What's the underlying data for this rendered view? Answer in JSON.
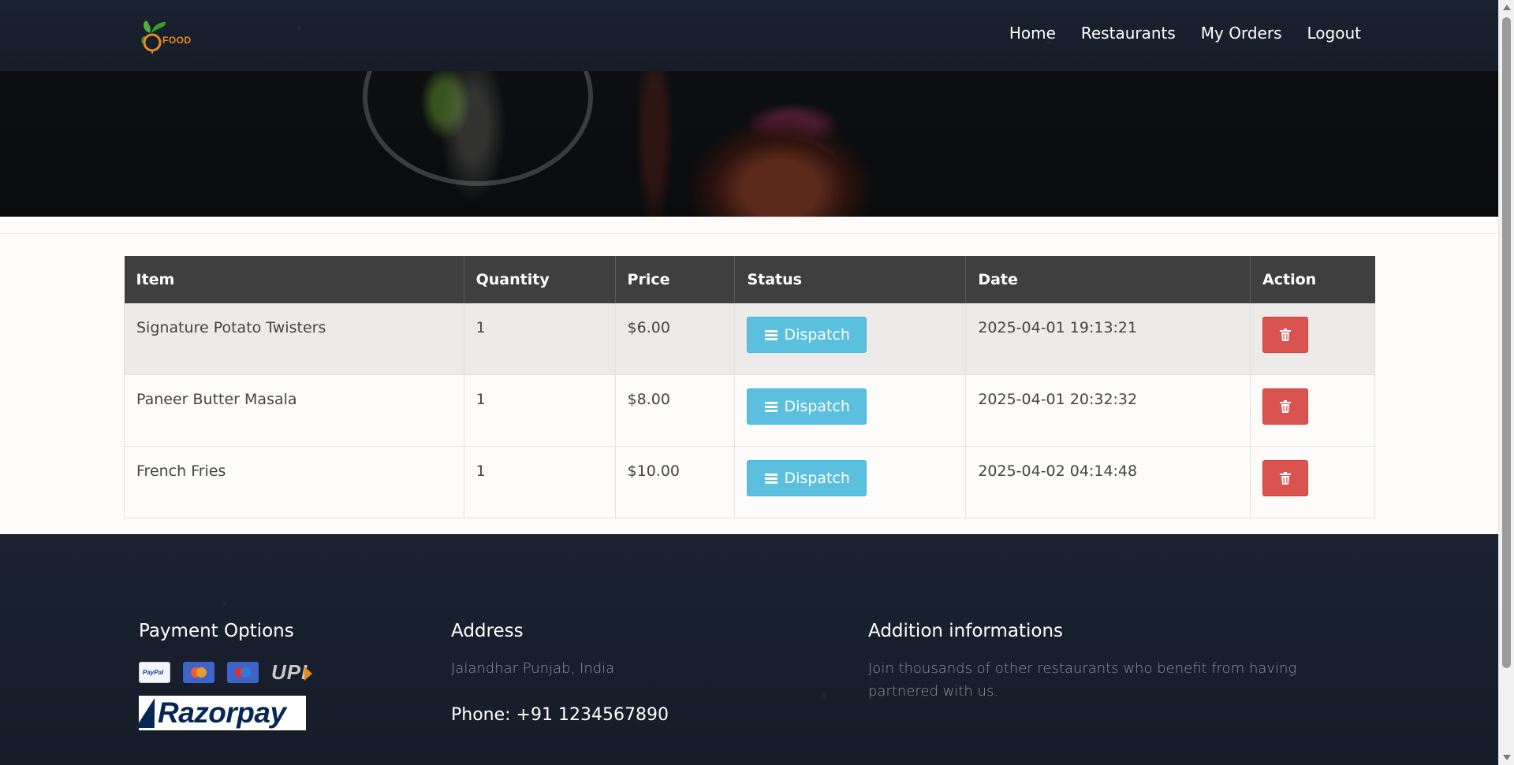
{
  "brand": {
    "logo_text": "FOOD"
  },
  "nav": [
    "Home",
    "Restaurants",
    "My Orders",
    "Logout"
  ],
  "table": {
    "headers": [
      "Item",
      "Quantity",
      "Price",
      "Status",
      "Date",
      "Action"
    ],
    "rows": [
      {
        "item": "Signature Potato Twisters",
        "quantity": "1",
        "price": "$6.00",
        "status": "Dispatch",
        "date": "2025-04-01 19:13:21"
      },
      {
        "item": "Paneer Butter Masala",
        "quantity": "1",
        "price": "$8.00",
        "status": "Dispatch",
        "date": "2025-04-01 20:32:32"
      },
      {
        "item": "French Fries",
        "quantity": "1",
        "price": "$10.00",
        "status": "Dispatch",
        "date": "2025-04-02 04:14:48"
      }
    ]
  },
  "footer": {
    "payment": {
      "title": "Payment Options",
      "paypal": "PayPal",
      "upi": "UPI",
      "razorpay": "Razorpay"
    },
    "address": {
      "title": "Address",
      "text": "Jalandhar Punjab, India",
      "phone": "Phone: +91 1234567890"
    },
    "info": {
      "title": "Addition informations",
      "text": "Join thousands of other restaurants who benefit from having partnered with us."
    }
  },
  "icons": {
    "logo": "leaf-logo-icon",
    "status": "bars-icon",
    "delete": "trash-icon"
  },
  "colors": {
    "dispatch": "#5bc0de",
    "delete": "#d9534f",
    "header_bg": "#1b2230",
    "table_head": "#3f3f3f"
  }
}
